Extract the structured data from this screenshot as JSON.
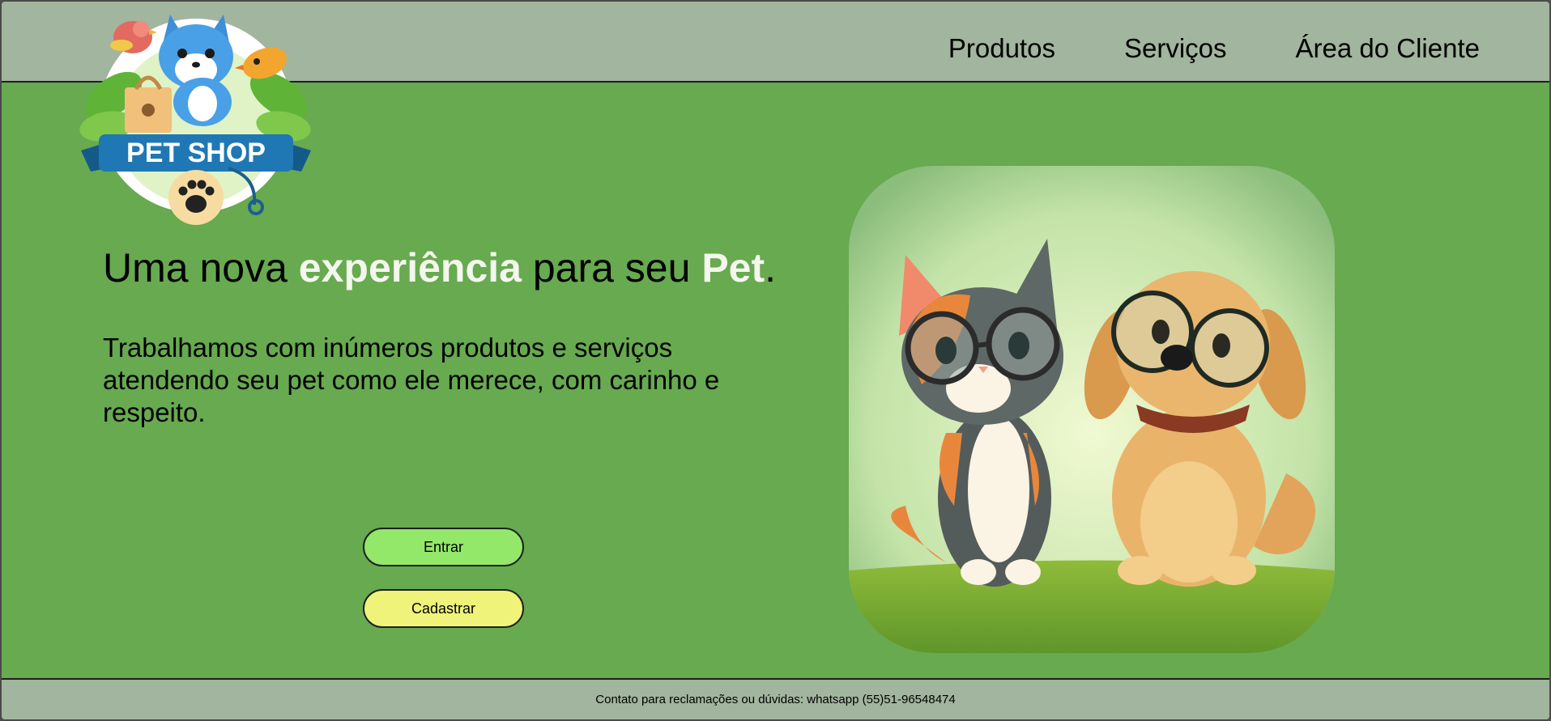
{
  "nav": {
    "items": [
      {
        "label": "Produtos"
      },
      {
        "label": "Serviços"
      },
      {
        "label": "Área do Cliente"
      }
    ]
  },
  "logo": {
    "text": "PET SHOP"
  },
  "hero": {
    "headline_part1": "Uma nova ",
    "headline_highlight1": "experiência",
    "headline_part2": " para seu ",
    "headline_highlight2": "Pet",
    "headline_end": ".",
    "lead": "Trabalhamos com inúmeros produtos e serviços atendendo seu pet como ele merece, com carinho e respeito.",
    "image_alt": "cat and dog wearing glasses"
  },
  "buttons": {
    "enter": "Entrar",
    "register": "Cadastrar"
  },
  "footer": {
    "contact": "Contato para reclamações ou dúvidas: whatsapp (55)51-96548474"
  },
  "colors": {
    "header_bg": "#a2b59e",
    "main_bg": "#67aa50",
    "enter_button": "#93e86a",
    "register_button": "#eff37a",
    "highlight_text": "#f4f7ee"
  }
}
